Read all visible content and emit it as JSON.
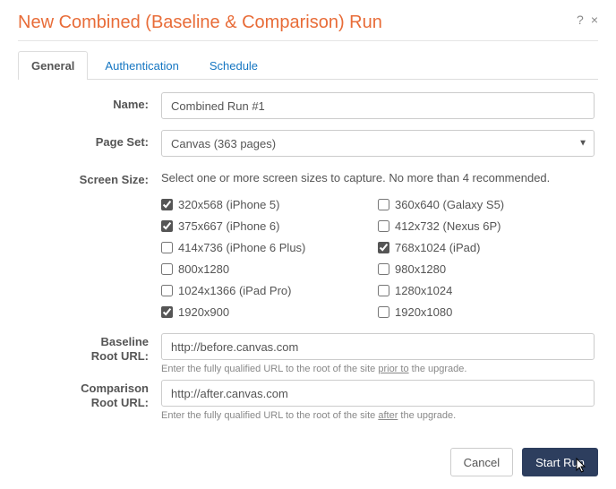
{
  "header": {
    "title": "New Combined (Baseline & Comparison) Run",
    "help_icon": "?",
    "close_icon": "×"
  },
  "tabs": {
    "general": "General",
    "authentication": "Authentication",
    "schedule": "Schedule",
    "active": "general"
  },
  "form": {
    "name_label": "Name:",
    "name_value": "Combined Run #1",
    "pageset_label": "Page Set:",
    "pageset_value": "Canvas (363 pages)",
    "screensize_label": "Screen Size:",
    "screensize_help": "Select one or more screen sizes to capture. No more than 4 recommended.",
    "baseline_label_l1": "Baseline",
    "baseline_label_l2": "Root URL:",
    "baseline_value": "http://before.canvas.com",
    "baseline_help_pre": "Enter the fully qualified URL to the root of the site ",
    "baseline_help_u": "prior to",
    "baseline_help_post": " the upgrade.",
    "comparison_label_l1": "Comparison",
    "comparison_label_l2": "Root URL:",
    "comparison_value": "http://after.canvas.com",
    "comparison_help_pre": "Enter the fully qualified URL to the root of the site ",
    "comparison_help_u": "after",
    "comparison_help_post": " the upgrade."
  },
  "screens": {
    "left": [
      {
        "label": "320x568 (iPhone 5)",
        "checked": true
      },
      {
        "label": "375x667 (iPhone 6)",
        "checked": true
      },
      {
        "label": "414x736 (iPhone 6 Plus)",
        "checked": false
      },
      {
        "label": "800x1280",
        "checked": false
      },
      {
        "label": "1024x1366 (iPad Pro)",
        "checked": false
      },
      {
        "label": "1920x900",
        "checked": true
      }
    ],
    "right": [
      {
        "label": "360x640 (Galaxy S5)",
        "checked": false
      },
      {
        "label": "412x732 (Nexus 6P)",
        "checked": false
      },
      {
        "label": "768x1024 (iPad)",
        "checked": true
      },
      {
        "label": "980x1280",
        "checked": false
      },
      {
        "label": "1280x1024",
        "checked": false
      },
      {
        "label": "1920x1080",
        "checked": false
      }
    ]
  },
  "footer": {
    "cancel": "Cancel",
    "start": "Start Run"
  }
}
